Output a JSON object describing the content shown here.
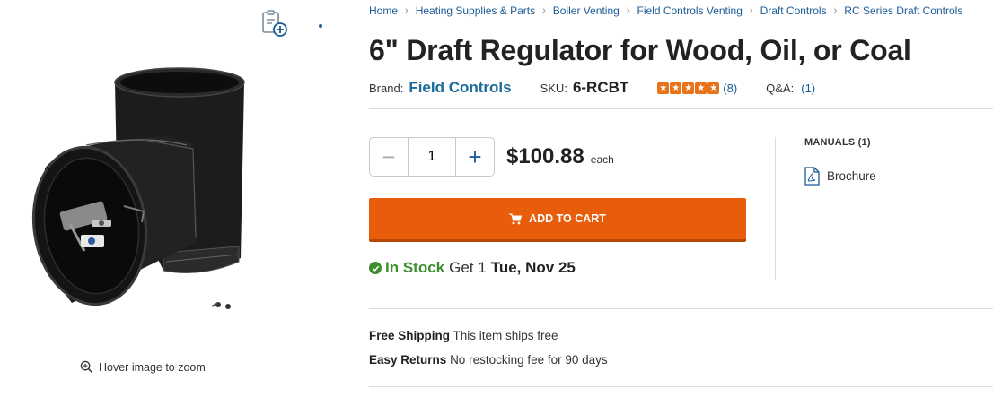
{
  "gallery": {
    "zoom_hint": "Hover image to zoom",
    "compare_icon": "clipboard-plus-icon",
    "zoom_icon": "magnifier-plus-icon"
  },
  "breadcrumb": [
    "Home",
    "Heating Supplies & Parts",
    "Boiler Venting",
    "Field Controls Venting",
    "Draft Controls",
    "RC Series Draft Controls"
  ],
  "product": {
    "title": "6\" Draft Regulator for Wood, Oil, or Coal",
    "brand_label": "Brand:",
    "brand": "Field Controls",
    "sku_label": "SKU:",
    "sku": "6-RCBT",
    "rating": 5,
    "reviews": "(8)",
    "qa_label": "Q&A:",
    "qa_count": "(1)"
  },
  "purchase": {
    "minus": "−",
    "plus": "+",
    "quantity": "1",
    "price": "$100.88",
    "price_unit": "each",
    "add_to_cart": "ADD TO CART",
    "cart_icon": "shopping-cart-icon"
  },
  "stock": {
    "status": "In Stock",
    "get_label": "Get 1",
    "date": "Tue, Nov 25"
  },
  "manuals": {
    "heading": "MANUALS (1)",
    "items": [
      "Brochure"
    ]
  },
  "shipping": {
    "label": "Free Shipping",
    "text": "This item ships free"
  },
  "returns": {
    "label": "Easy Returns",
    "text": "No restocking fee for 90 days"
  },
  "colors": {
    "accent": "#e85d0c",
    "link": "#1a5a96",
    "in_stock": "#3e8e2e",
    "star": "#e8731a"
  }
}
